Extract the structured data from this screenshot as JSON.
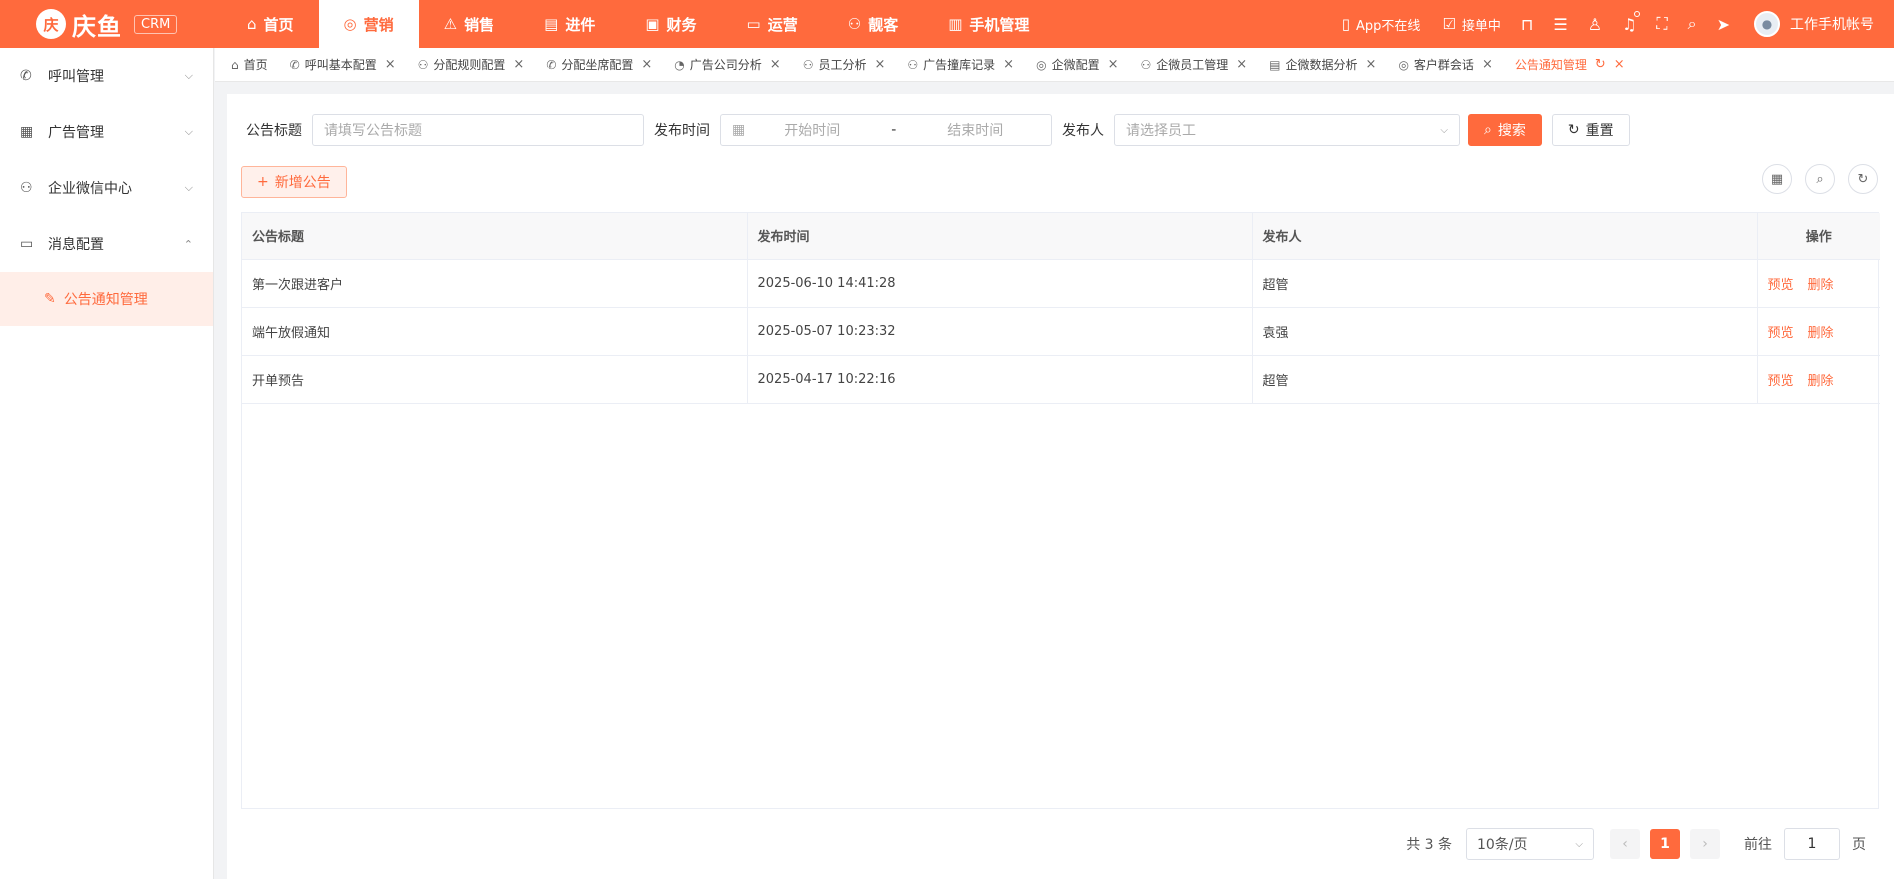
{
  "brand": {
    "logo_glyph": "庆",
    "name": "庆鱼",
    "tag": "CRM"
  },
  "topnav": [
    {
      "label": "首页",
      "icon": "⌂"
    },
    {
      "label": "营销",
      "icon": "◎"
    },
    {
      "label": "销售",
      "icon": "⚠"
    },
    {
      "label": "进件",
      "icon": "▤"
    },
    {
      "label": "财务",
      "icon": "▣"
    },
    {
      "label": "运营",
      "icon": "▭"
    },
    {
      "label": "靓客",
      "icon": "⚇"
    },
    {
      "label": "手机管理",
      "icon": "▥"
    }
  ],
  "topright": {
    "app_status": "App不在线",
    "order_status": "接单中",
    "account": "工作手机帐号"
  },
  "sidebar": {
    "items": [
      {
        "label": "呼叫管理",
        "icon": "✆",
        "chev": "⌵"
      },
      {
        "label": "广告管理",
        "icon": "▦",
        "chev": "⌵"
      },
      {
        "label": "企业微信中心",
        "icon": "⚇",
        "chev": "⌵"
      },
      {
        "label": "消息配置",
        "icon": "▭",
        "chev": "⌃"
      }
    ],
    "sub_item": {
      "label": "公告通知管理",
      "icon": "✎"
    }
  },
  "tabs": [
    {
      "label": "首页",
      "icon": "⌂"
    },
    {
      "label": "呼叫基本配置",
      "icon": "✆",
      "close": "×"
    },
    {
      "label": "分配规则配置",
      "icon": "⚇",
      "close": "×"
    },
    {
      "label": "分配坐席配置",
      "icon": "✆",
      "close": "×"
    },
    {
      "label": "广告公司分析",
      "icon": "◔",
      "close": "×"
    },
    {
      "label": "员工分析",
      "icon": "⚇",
      "close": "×"
    },
    {
      "label": "广告撞库记录",
      "icon": "⚇",
      "close": "×"
    },
    {
      "label": "企微配置",
      "icon": "◎",
      "close": "×"
    },
    {
      "label": "企微员工管理",
      "icon": "⚇",
      "close": "×"
    },
    {
      "label": "企微数据分析",
      "icon": "▤",
      "close": "×"
    },
    {
      "label": "客户群会话",
      "icon": "◎",
      "close": "×"
    },
    {
      "label": "公告通知管理",
      "refresh": "↻",
      "close": "×"
    }
  ],
  "filter": {
    "title_label": "公告标题",
    "title_placeholder": "请填写公告标题",
    "time_label": "发布时间",
    "start_placeholder": "开始时间",
    "range_sep": "-",
    "end_placeholder": "结束时间",
    "publisher_label": "发布人",
    "publisher_placeholder": "请选择员工",
    "search_label": "搜索",
    "reset_label": "重置"
  },
  "toolbar": {
    "add_label": "新增公告"
  },
  "table": {
    "columns": [
      "公告标题",
      "发布时间",
      "发布人",
      "操作"
    ],
    "rows": [
      {
        "title": "第一次跟进客户",
        "time": "2025-06-10 14:41:28",
        "publisher": "超管"
      },
      {
        "title": "端午放假通知",
        "time": "2025-05-07 10:23:32",
        "publisher": "袁强"
      },
      {
        "title": "开单预告",
        "time": "2025-04-17 10:22:16",
        "publisher": "超管"
      }
    ],
    "actions": {
      "preview": "预览",
      "delete": "删除"
    }
  },
  "pagination": {
    "total_text": "共 3 条",
    "page_size": "10条/页",
    "current_page": "1",
    "jump_prefix": "前往",
    "jump_value": "1",
    "jump_suffix": "页"
  },
  "colors": {
    "brand": "#ff6a3d"
  }
}
